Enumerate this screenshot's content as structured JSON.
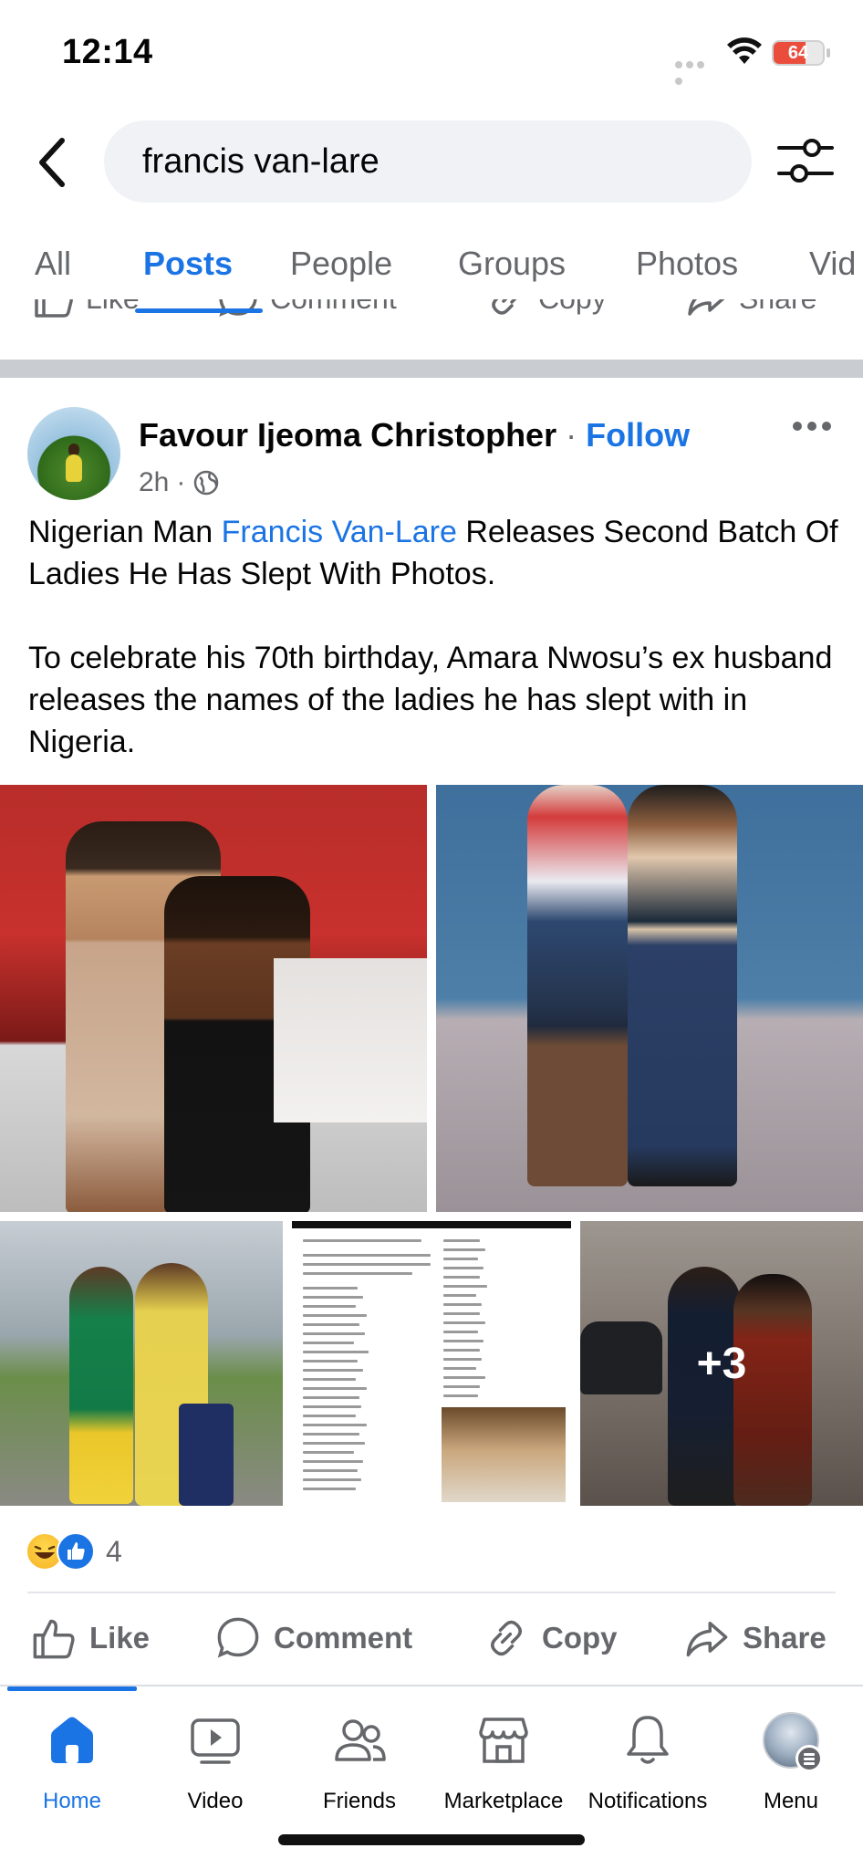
{
  "status_bar": {
    "time": "12:14",
    "battery": "64"
  },
  "search": {
    "query": "francis van-lare"
  },
  "tabs": [
    {
      "label": "All"
    },
    {
      "label": "Posts"
    },
    {
      "label": "People"
    },
    {
      "label": "Groups"
    },
    {
      "label": "Photos"
    },
    {
      "label": "Vid"
    }
  ],
  "prev_actions": {
    "like": "Like",
    "comment": "Comment",
    "copy": "Copy",
    "share": "Share"
  },
  "post": {
    "author": "Favour Ijeoma Christopher",
    "separator": "·",
    "follow": "Follow",
    "time": "2h",
    "time_sep": "·",
    "text_before_mention": "Nigerian Man ",
    "mention": "Francis Van-Lare",
    "text_after_mention": " Releases Second Batch Of Ladies He Has Slept With Photos.",
    "paragraph2": "To celebrate his 70th birthday, Amara Nwosu’s ex husband releases the names of the ladies he has slept with in Nigeria.",
    "more_photos": "+3",
    "reaction_count": "4"
  },
  "actions": {
    "like": "Like",
    "comment": "Comment",
    "copy": "Copy",
    "share": "Share"
  },
  "nav": [
    {
      "label": "Home"
    },
    {
      "label": "Video"
    },
    {
      "label": "Friends"
    },
    {
      "label": "Marketplace"
    },
    {
      "label": "Notifications"
    },
    {
      "label": "Menu"
    }
  ],
  "colors": {
    "accent": "#1b74e4",
    "secondary_text": "#65676b",
    "search_bg": "#f0f2f5",
    "divider": "#c9ccd1"
  },
  "icons": [
    "back-icon",
    "filter-icon",
    "globe-icon",
    "more-icon",
    "like-icon",
    "comment-icon",
    "copy-icon",
    "share-icon",
    "home-icon",
    "video-icon",
    "friends-icon",
    "marketplace-icon",
    "notifications-icon"
  ]
}
